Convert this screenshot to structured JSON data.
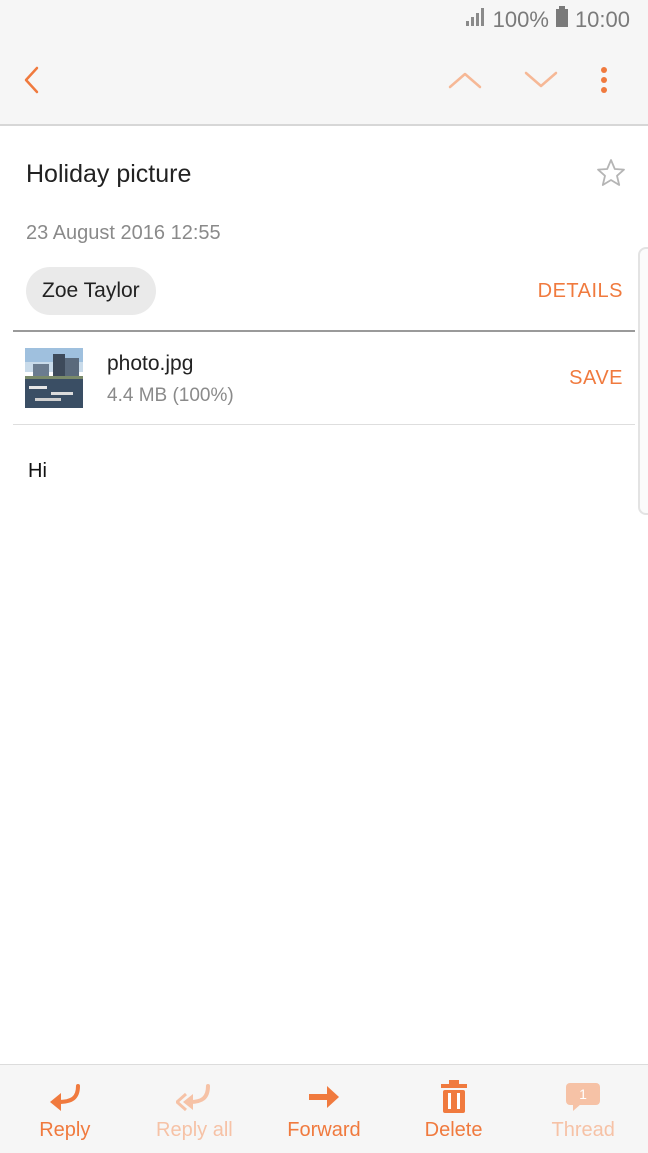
{
  "status_bar": {
    "battery": "100%",
    "time": "10:00",
    "icons": [
      "signal-icon",
      "battery-icon"
    ]
  },
  "app_bar": {
    "icons": [
      "back-arrow-icon",
      "previous-mail-icon",
      "next-mail-icon",
      "more-options-icon"
    ]
  },
  "email": {
    "subject": "Holiday picture",
    "date": "23 August 2016  12:55",
    "sender": "Zoe Taylor",
    "details_label": "DETAILS",
    "attachment": {
      "name": "photo.jpg",
      "size": "4.4 MB (100%)",
      "save_label": "SAVE"
    },
    "body": "Hi"
  },
  "bottom_bar": {
    "reply": "Reply",
    "reply_all": "Reply all",
    "forward": "Forward",
    "delete": "Delete",
    "thread": "Thread",
    "thread_count": "1"
  },
  "colors": {
    "accent": "#f07a3e",
    "accent_disabled": "#f6c2a6",
    "bar_bg": "#f6f6f6"
  }
}
